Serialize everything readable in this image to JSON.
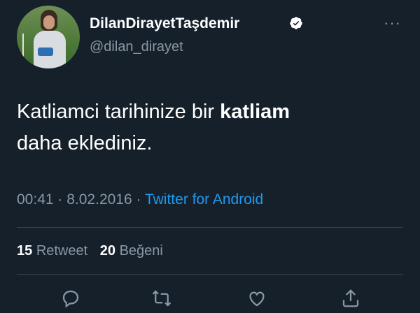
{
  "user": {
    "display_name": "DilanDirayetTaşdemir",
    "handle": "@dilan_dirayet",
    "verified_icon": "verified-badge-icon",
    "more_icon": "more-options-icon",
    "more_label": "···"
  },
  "tweet": {
    "text_before": "Katliamci tarihinize bir ",
    "text_bold": "katliam",
    "text_after": "daha eklediniz."
  },
  "meta": {
    "time": "00:41",
    "separator": " · ",
    "date": "8.02.2016",
    "source": "Twitter for Android"
  },
  "stats": {
    "retweet_count": "15",
    "retweet_label": "Retweet",
    "like_count": "20",
    "like_label": "Beğeni"
  },
  "actions": [
    "reply-icon",
    "retweet-icon",
    "like-icon",
    "share-icon"
  ],
  "colors": {
    "background": "#15202b",
    "text": "#ffffff",
    "secondary": "#8b98a5",
    "link": "#1d9bf0",
    "divider": "#38444d"
  }
}
